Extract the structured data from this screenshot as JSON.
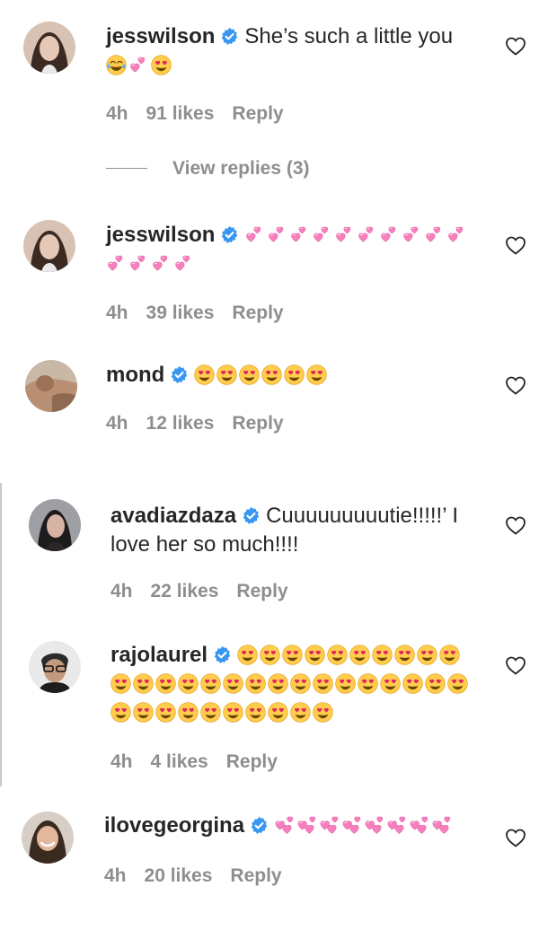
{
  "comments": [
    {
      "username": "jesswilson",
      "text": "She’s such a little you",
      "emojis_after": [
        "joy-emoji",
        "two-hearts-emoji",
        "heart-eyes-emoji"
      ],
      "time": "4h",
      "likes": "91 likes",
      "reply": "Reply"
    },
    {
      "username": "jesswilson",
      "text": "",
      "emojis_after": [
        "two-hearts-emoji"
      ],
      "emoji_count": 14,
      "time": "4h",
      "likes": "39 likes",
      "reply": "Reply"
    },
    {
      "username": "mond",
      "text": "",
      "emojis_after": [
        "heart-eyes-emoji"
      ],
      "emoji_count": 6,
      "time": "4h",
      "likes": "12 likes",
      "reply": "Reply"
    },
    {
      "username": "avadiazdaza",
      "text": "Cuuuuuuuuutie!!!!!’ I love her so much!!!!",
      "time": "4h",
      "likes": "22 likes",
      "reply": "Reply"
    },
    {
      "username": "rajolaurel",
      "text": "",
      "emojis_after": [
        "heart-eyes-emoji"
      ],
      "emoji_count": 36,
      "time": "4h",
      "likes": "4 likes",
      "reply": "Reply"
    },
    {
      "username": "ilovegeorgina",
      "text": "",
      "emojis_after": [
        "revolving-hearts-emoji"
      ],
      "emoji_count": 8,
      "time": "4h",
      "likes": "20 likes",
      "reply": "Reply"
    }
  ],
  "view_replies": "View replies (3)",
  "colors": {
    "text": "#262626",
    "meta": "#8e8e8e",
    "verified_badge": "#3897f0",
    "heart_pink": "#f77fbe",
    "emoji_yellow": "#ffcc4d",
    "emoji_red": "#e0245e"
  },
  "icons": {
    "verified": "verified-badge-icon",
    "like": "heart-outline-icon"
  }
}
